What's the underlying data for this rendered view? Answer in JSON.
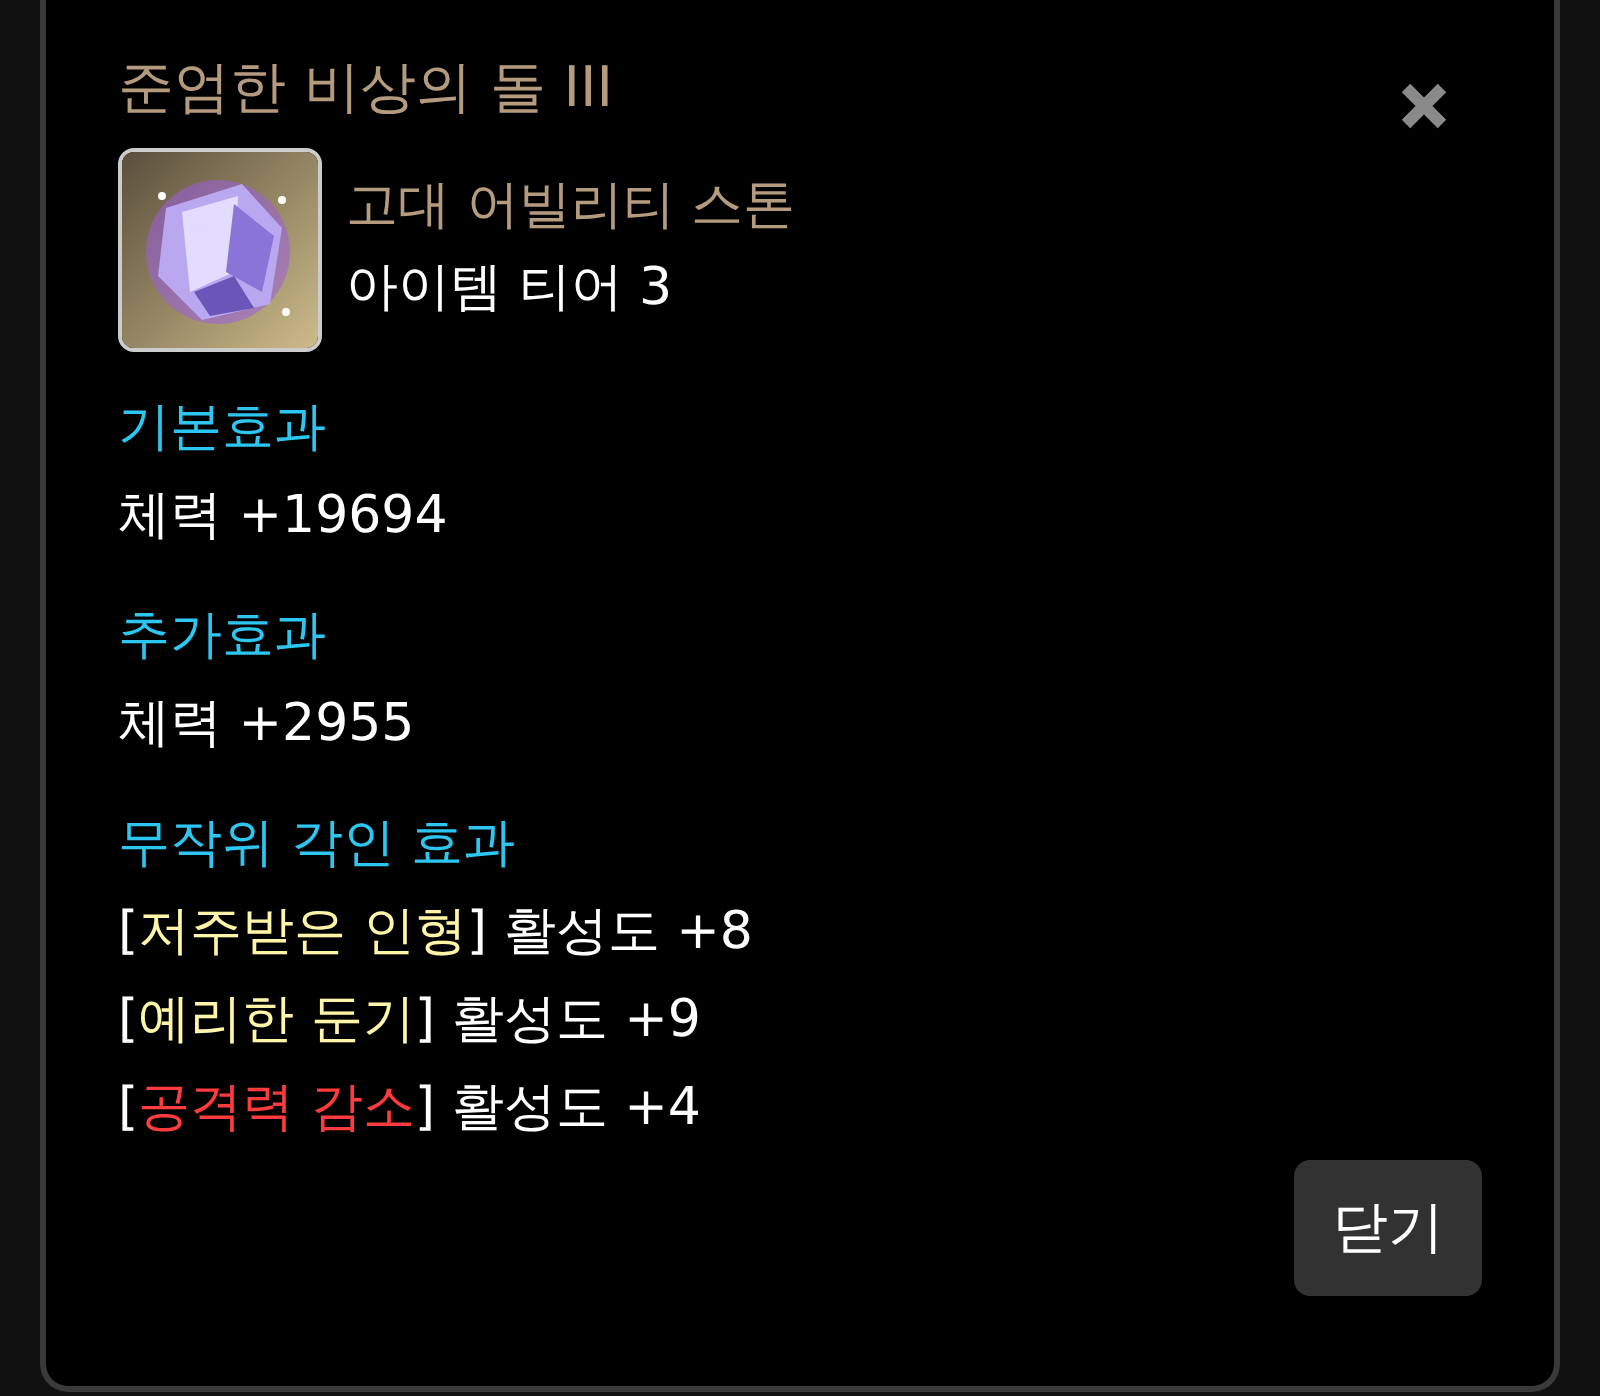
{
  "title": "준엄한 비상의 돌 III",
  "item": {
    "kind": "picture",
    "category": "고대 어빌리티 스톤",
    "tier": "아이템 티어 3"
  },
  "sections": [
    {
      "heading": "기본효과",
      "lines": [
        "체력 +19694"
      ]
    },
    {
      "heading": "추가효과",
      "lines": [
        "체력 +2955"
      ]
    }
  ],
  "engravings": {
    "heading": "무작위 각인 효과",
    "items": [
      {
        "open": "[",
        "name": "저주받은 인형",
        "close": "]",
        "effect": "활성도 +8",
        "color": "#fff5a8"
      },
      {
        "open": "[",
        "name": "예리한 둔기",
        "close": "]",
        "effect": "활성도 +9",
        "color": "#fff5a8"
      },
      {
        "open": "[",
        "name": "공격력 감소",
        "close": "]",
        "effect": "활성도 +4",
        "color": "#ff3b3b"
      }
    ]
  },
  "buttons": [
    "닫기"
  ]
}
